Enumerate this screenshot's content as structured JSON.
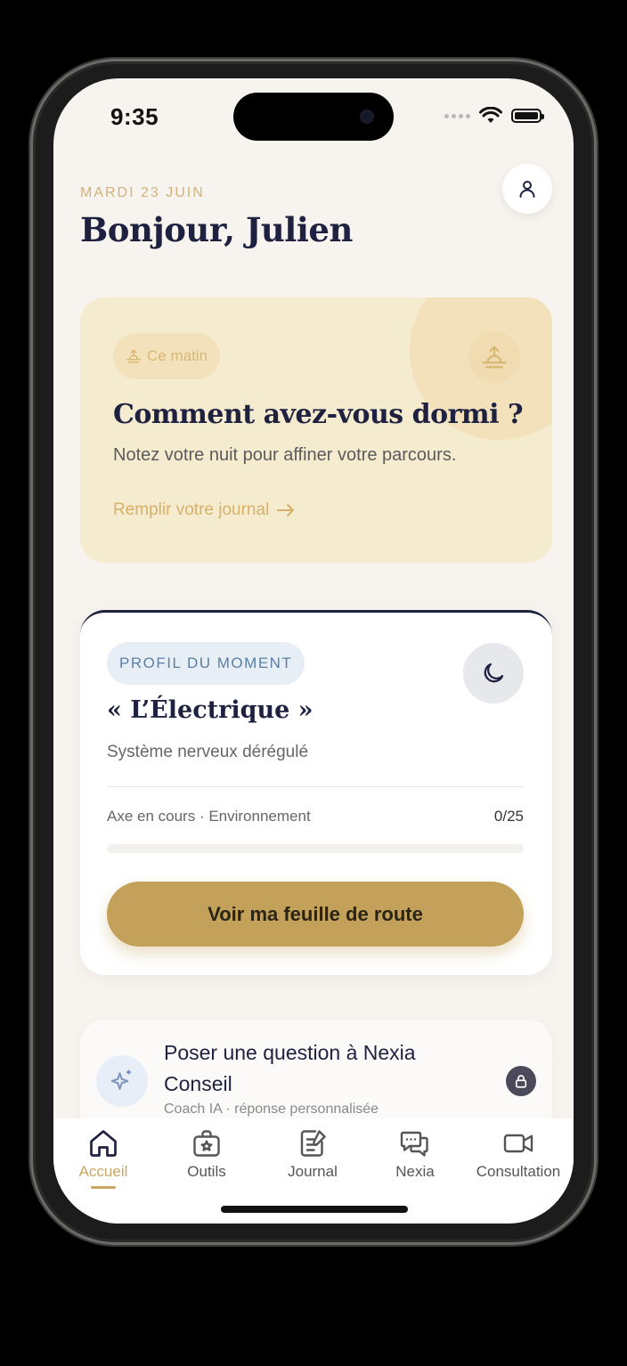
{
  "status_bar": {
    "time": "9:35"
  },
  "header": {
    "date": "MARDI 23 JUIN",
    "greeting": "Bonjour, Julien"
  },
  "sleep_card": {
    "chip": "Ce matin",
    "title": "Comment avez-vous dormi ?",
    "subtitle": "Notez votre nuit pour affiner votre parcours.",
    "link": "Remplir votre journal"
  },
  "profile_card": {
    "chip": "PROFIL DU MOMENT",
    "name": "« L’Électrique »",
    "subtitle": "Système nerveux dérégulé",
    "axis_label": "Axe en cours · Environnement",
    "axis_count": "0/25",
    "progress": 0,
    "cta": "Voir ma feuille de route"
  },
  "nexia_card": {
    "title": "Poser une question à Nexia Conseil",
    "subtitle": "Coach IA · réponse personnalisée"
  },
  "tabs": [
    {
      "label": "Accueil",
      "icon": "home-icon",
      "active": true
    },
    {
      "label": "Outils",
      "icon": "toolbox-icon",
      "active": false
    },
    {
      "label": "Journal",
      "icon": "journal-icon",
      "active": false
    },
    {
      "label": "Nexia",
      "icon": "chat-icon",
      "active": false
    },
    {
      "label": "Consultation",
      "icon": "video-icon",
      "active": false
    }
  ],
  "colors": {
    "accent_gold": "#c4a15a",
    "navy": "#1e2140",
    "background": "#f7f3ee",
    "sleep_card_bg": "#f5ebcf",
    "profile_chip_bg": "#e8eef6"
  }
}
